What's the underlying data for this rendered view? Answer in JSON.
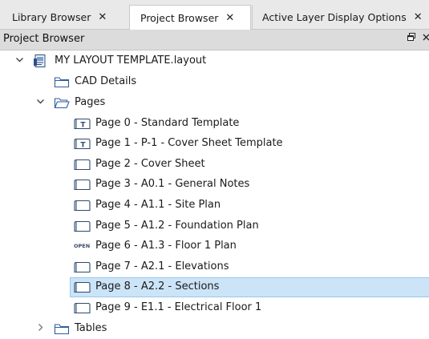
{
  "tabs": [
    {
      "label": "Library Browser",
      "close": "✕",
      "active": false
    },
    {
      "label": "Project Browser",
      "close": "✕",
      "active": true
    },
    {
      "label": "Active Layer Display Options",
      "close": "✕",
      "active": false
    }
  ],
  "panel": {
    "title": "Project Browser",
    "controls": [
      "float-icon",
      "close-icon"
    ]
  },
  "tree": {
    "root": {
      "label": "MY LAYOUT TEMPLATE.layout",
      "expanded": true,
      "icon": "layout-file-icon"
    },
    "cad_details": {
      "label": "CAD Details",
      "icon": "folder-icon"
    },
    "pages": {
      "label": "Pages",
      "expanded": true,
      "icon": "folder-open-icon"
    },
    "page_items": [
      {
        "label": "Page 0 - Standard Template",
        "icon": "template-page-icon"
      },
      {
        "label": "Page 1 - P-1 - Cover Sheet Template",
        "icon": "template-page-icon"
      },
      {
        "label": "Page 2 - Cover Sheet",
        "icon": "page-icon"
      },
      {
        "label": "Page 3 - A0.1 - General Notes",
        "icon": "page-icon"
      },
      {
        "label": "Page 4 - A1.1 - Site Plan",
        "icon": "page-icon"
      },
      {
        "label": "Page 5 - A1.2 - Foundation Plan",
        "icon": "page-icon"
      },
      {
        "label": "Page 6 - A1.3 - Floor 1 Plan",
        "icon": "open-page-icon",
        "badge": "OPEN"
      },
      {
        "label": "Page 7 - A2.1 - Elevations",
        "icon": "page-icon"
      },
      {
        "label": "Page 8 - A2.2 - Sections",
        "icon": "page-icon",
        "selected": true
      },
      {
        "label": "Page 9 - E1.1 - Electrical Floor 1",
        "icon": "page-icon"
      }
    ],
    "tables": {
      "label": "Tables",
      "expanded": false,
      "icon": "folder-icon"
    }
  },
  "colors": {
    "selection": "#cce4f7",
    "selection_border": "#99c9ef",
    "folder_outline": "#2f5e9e",
    "panel_header": "#dcdcdc"
  }
}
